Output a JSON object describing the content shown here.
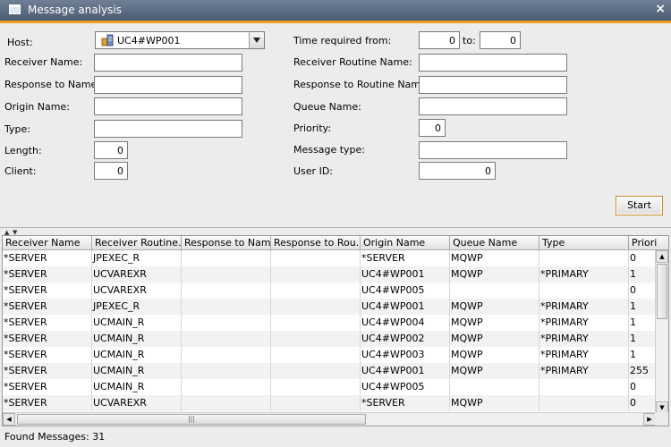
{
  "window": {
    "title": "Message analysis",
    "close_glyph": "×"
  },
  "form": {
    "host_label": "Host:",
    "host_value": "UC4#WP001",
    "receiver_name_label": "Receiver Name:",
    "response_to_name_label": "Response to Name:",
    "origin_name_label": "Origin Name:",
    "type_label": "Type:",
    "length_label": "Length:",
    "length_value": "0",
    "client_label": "Client:",
    "client_value": "0",
    "time_required_from_label": "Time required from:",
    "time_from_value": "0",
    "to_label": "to:",
    "time_to_value": "0",
    "receiver_routine_name_label": "Receiver Routine Name:",
    "response_to_routine_name_label": "Response to Routine Name:",
    "queue_name_label": "Queue Name:",
    "priority_label": "Priority:",
    "priority_value": "0",
    "message_type_label": "Message type:",
    "user_id_label": "User ID:",
    "user_id_value": "0",
    "start_label": "Start"
  },
  "table": {
    "columns": [
      "Receiver Name",
      "Receiver Routine...",
      "Response to Name",
      "Response to Rou...",
      "Origin Name",
      "Queue Name",
      "Type",
      "Priori"
    ],
    "rows": [
      [
        "*SERVER",
        "JPEXEC_R",
        "",
        "",
        "*SERVER",
        "MQWP",
        "",
        "0"
      ],
      [
        "*SERVER",
        "UCVAREXR",
        "",
        "",
        "UC4#WP001",
        "MQWP",
        "*PRIMARY",
        "1"
      ],
      [
        "*SERVER",
        "UCVAREXR",
        "",
        "",
        "UC4#WP005",
        "",
        "",
        "0"
      ],
      [
        "*SERVER",
        "JPEXEC_R",
        "",
        "",
        "UC4#WP001",
        "MQWP",
        "*PRIMARY",
        "1"
      ],
      [
        "*SERVER",
        "UCMAIN_R",
        "",
        "",
        "UC4#WP004",
        "MQWP",
        "*PRIMARY",
        "1"
      ],
      [
        "*SERVER",
        "UCMAIN_R",
        "",
        "",
        "UC4#WP002",
        "MQWP",
        "*PRIMARY",
        "1"
      ],
      [
        "*SERVER",
        "UCMAIN_R",
        "",
        "",
        "UC4#WP003",
        "MQWP",
        "*PRIMARY",
        "1"
      ],
      [
        "*SERVER",
        "UCMAIN_R",
        "",
        "",
        "UC4#WP001",
        "MQWP",
        "*PRIMARY",
        "255"
      ],
      [
        "*SERVER",
        "UCMAIN_R",
        "",
        "",
        "UC4#WP005",
        "",
        "",
        "0"
      ],
      [
        "*SERVER",
        "UCVAREXR",
        "",
        "",
        "*SERVER",
        "MQWP",
        "",
        "0"
      ]
    ]
  },
  "status": {
    "found_messages": "Found Messages: 31"
  },
  "colors": {
    "accent": "#f0a020",
    "titlebar": "#5c6c82",
    "start_border": "#c8922a"
  },
  "icons": {
    "window": "window-icon",
    "host": "server-icon",
    "dropdown": "chevron-down-icon",
    "close": "close-icon"
  }
}
